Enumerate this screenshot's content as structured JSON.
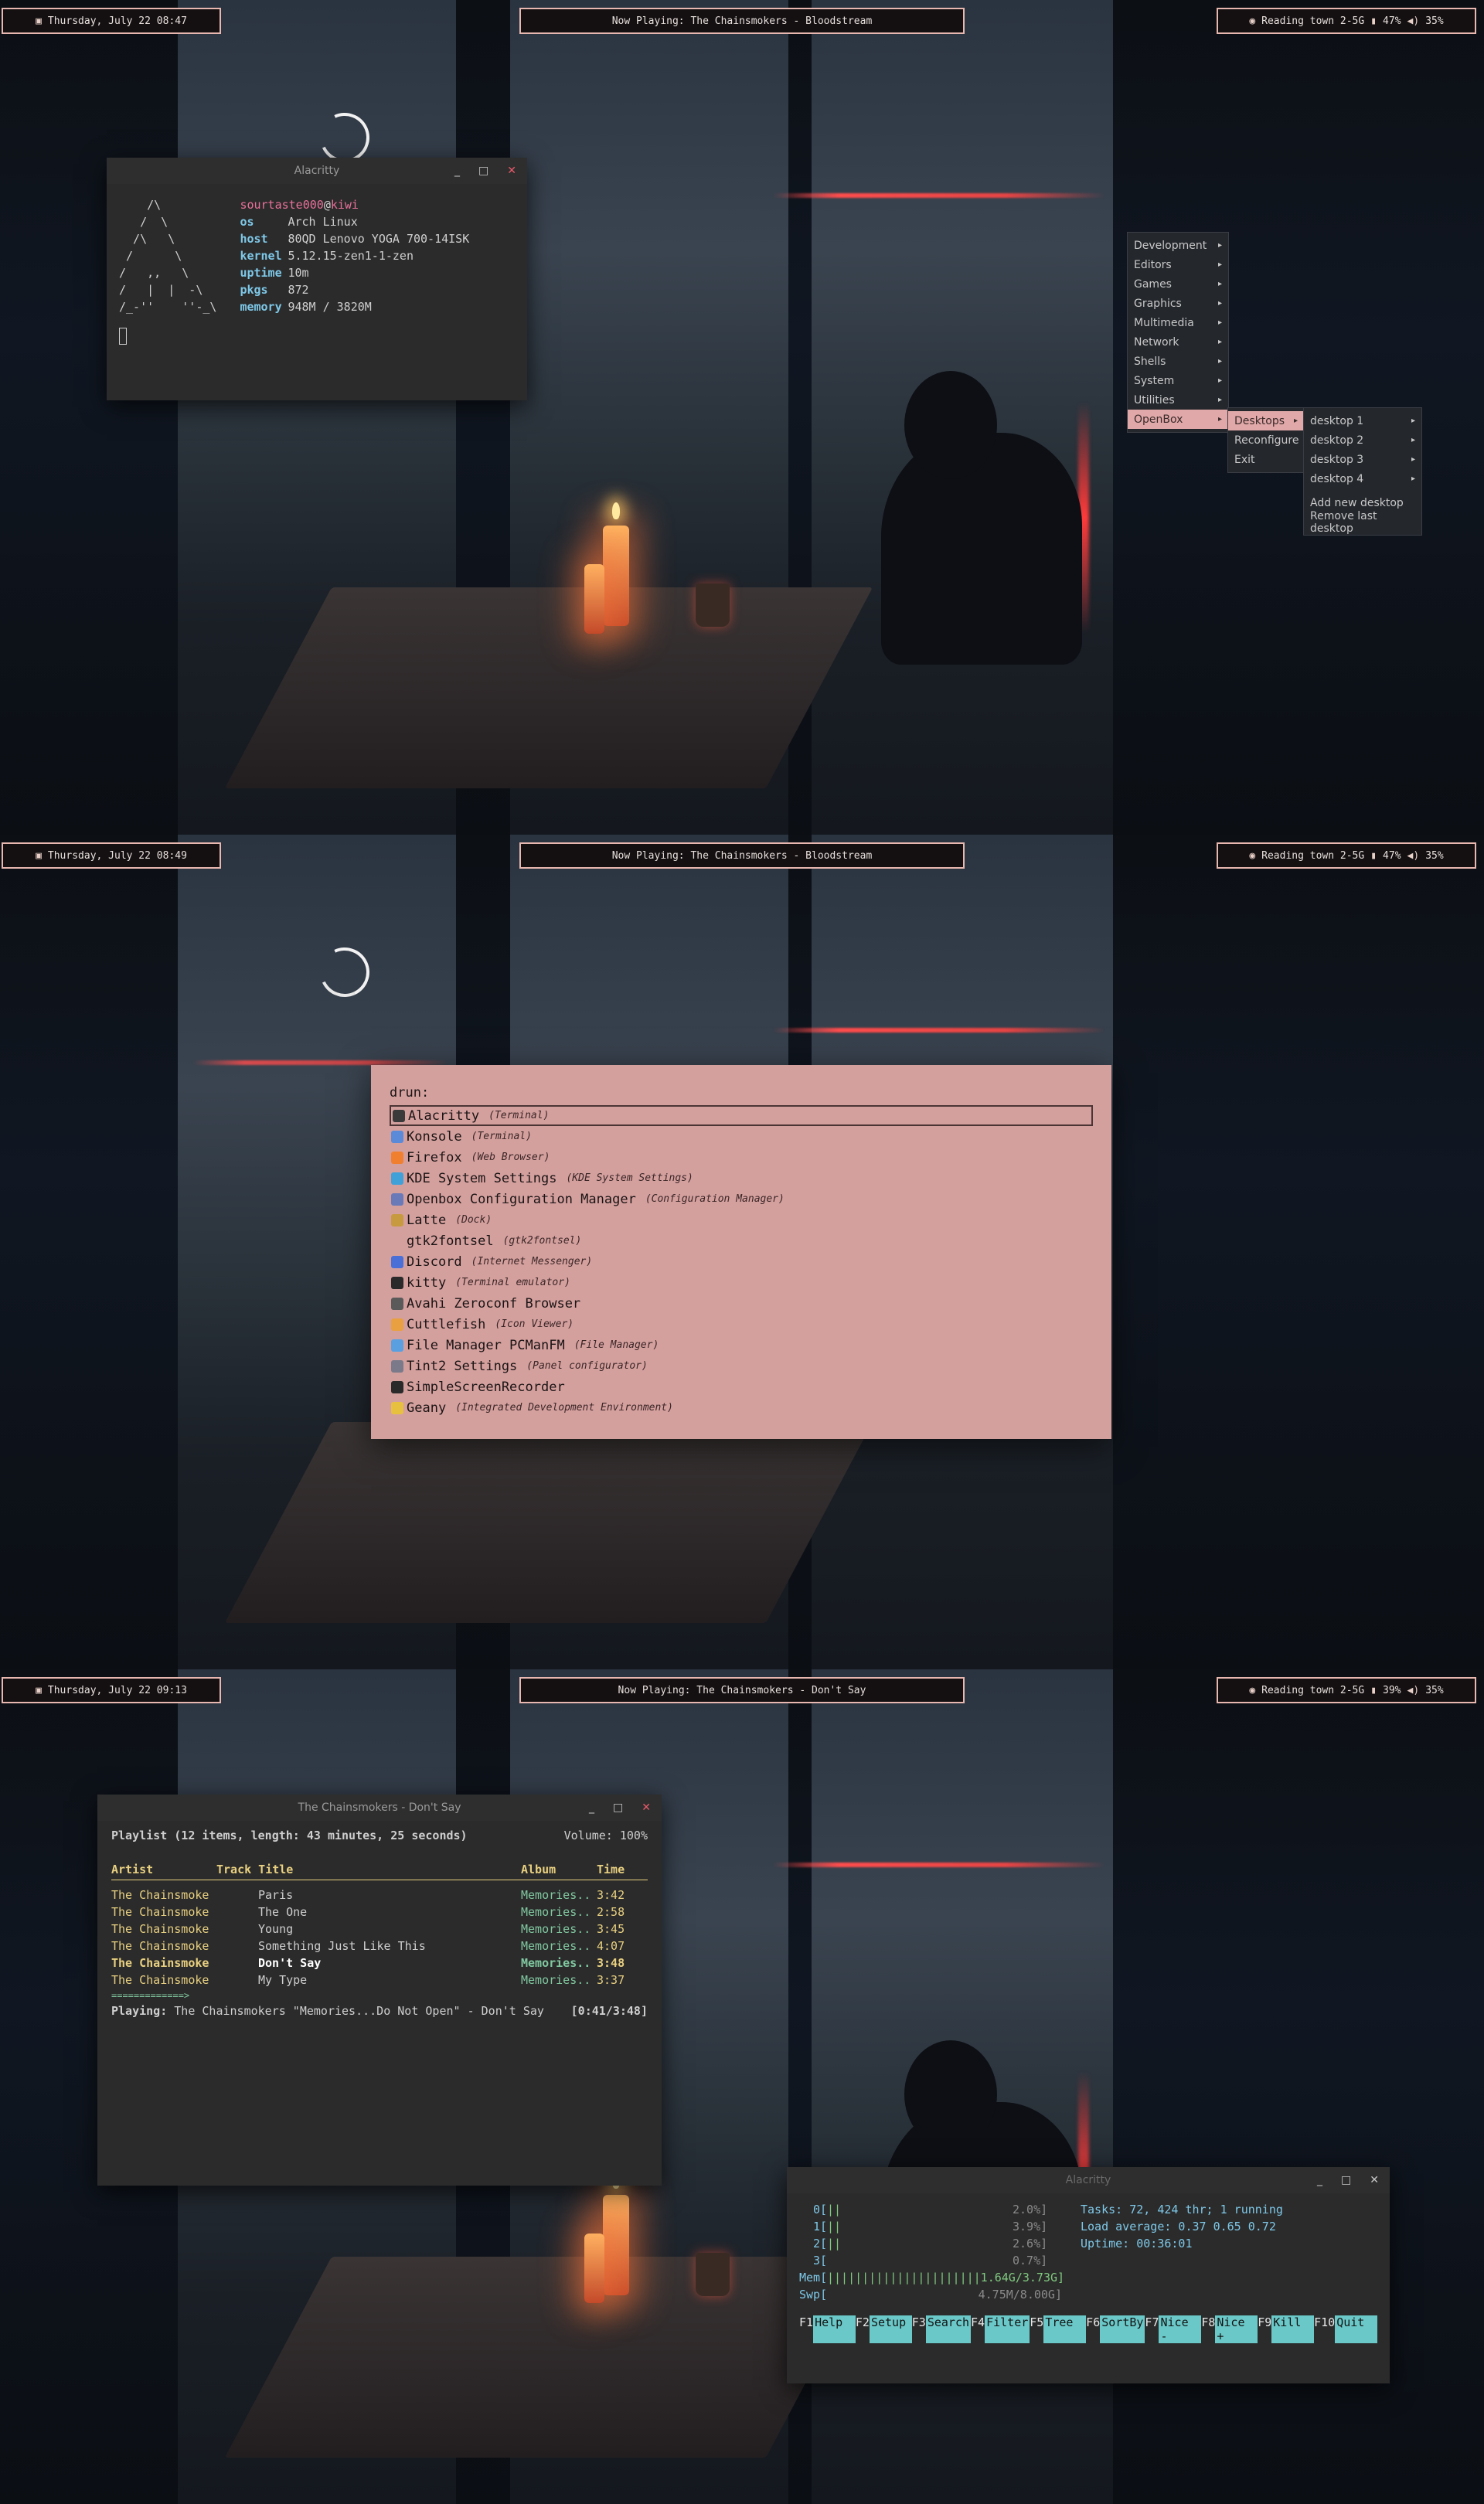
{
  "screens": [
    {
      "bar": {
        "date_icon": "calendar-icon",
        "date": "Thursday, July 22 08:47",
        "now_playing": "Now Playing: The Chainsmokers - Bloodstream",
        "status": "Reading town 2-5G",
        "battery": "47%",
        "volume": "35%"
      },
      "neofetch": {
        "title": "Alacritty",
        "logo": [
          "    /\\",
          "   /  \\",
          "  /\\   \\",
          " /      \\",
          "/   ,,   \\",
          "/   |  |  -\\",
          "/_-''    ''-_\\"
        ],
        "user_host": "sourtaste000@kiwi",
        "user": "sourtaste000",
        "at": "@",
        "host_name": "kiwi",
        "rows": [
          {
            "k": "os",
            "v": "Arch Linux"
          },
          {
            "k": "host",
            "v": "80QD Lenovo YOGA 700-14ISK"
          },
          {
            "k": "kernel",
            "v": "5.12.15-zen1-1-zen"
          },
          {
            "k": "uptime",
            "v": "10m"
          },
          {
            "k": "pkgs",
            "v": "872"
          },
          {
            "k": "memory",
            "v": "948M / 3820M"
          }
        ]
      },
      "menu": {
        "items": [
          "Development",
          "Editors",
          "Games",
          "Graphics",
          "Multimedia",
          "Network",
          "Shells",
          "System",
          "Utilities",
          "OpenBox"
        ],
        "openbox_sub": [
          "Desktops",
          "Reconfigure",
          "Exit"
        ],
        "desktops_sub": [
          "desktop 1",
          "desktop 2",
          "desktop 3",
          "desktop 4",
          "Add new desktop",
          "Remove last desktop"
        ]
      }
    },
    {
      "bar": {
        "date": "Thursday, July 22 08:49",
        "now_playing": "Now Playing: The Chainsmokers - Bloodstream",
        "status": "Reading town 2-5G",
        "battery": "47%",
        "volume": "35%"
      },
      "drun": {
        "prompt": "drun:",
        "items": [
          {
            "name": "Alacritty",
            "sub": "(Terminal)",
            "color": "#3a3a3a"
          },
          {
            "name": "Konsole",
            "sub": "(Terminal)",
            "color": "#5a8ad8"
          },
          {
            "name": "Firefox",
            "sub": "(Web Browser)",
            "color": "#f08030"
          },
          {
            "name": "KDE System Settings",
            "sub": "(KDE System Settings)",
            "color": "#40a0d8"
          },
          {
            "name": "Openbox Configuration Manager",
            "sub": "(Configuration Manager)",
            "color": "#6a7ab8"
          },
          {
            "name": "Latte",
            "sub": "(Dock)",
            "color": "#c89a40"
          },
          {
            "name": "gtk2fontsel",
            "sub": "(gtk2fontsel)",
            "color": "transparent"
          },
          {
            "name": "Discord",
            "sub": "(Internet Messenger)",
            "color": "#4a70d8"
          },
          {
            "name": "kitty",
            "sub": "(Terminal emulator)",
            "color": "#2a2a2a"
          },
          {
            "name": "Avahi Zeroconf Browser",
            "sub": "",
            "color": "#5a5a5a"
          },
          {
            "name": "Cuttlefish",
            "sub": "(Icon Viewer)",
            "color": "#e8a040"
          },
          {
            "name": "File Manager PCManFM",
            "sub": "(File Manager)",
            "color": "#5aa0e0"
          },
          {
            "name": "Tint2 Settings",
            "sub": "(Panel configurator)",
            "color": "#7a7a8a"
          },
          {
            "name": "SimpleScreenRecorder",
            "sub": "",
            "color": "#2a2a2a"
          },
          {
            "name": "Geany",
            "sub": "(Integrated Development Environment)",
            "color": "#e8c040"
          }
        ]
      }
    },
    {
      "bar": {
        "date": "Thursday, July 22 09:13",
        "now_playing": "Now Playing: The Chainsmokers - Don't Say",
        "status": "Reading town 2-5G",
        "battery": "39%",
        "volume": "35%"
      },
      "mpc": {
        "title": "The Chainsmokers - Don't Say",
        "playlist_header": "Playlist (12 items, length: 43 minutes, 25 seconds)",
        "volume": "Volume: 100%",
        "cols": [
          "Artist",
          "Track Title",
          "Album",
          "Time"
        ],
        "rows": [
          {
            "artist": "The Chainsmoke",
            "title": "Paris",
            "album": "Memories..",
            "time": "3:42"
          },
          {
            "artist": "The Chainsmoke",
            "title": "The One",
            "album": "Memories..",
            "time": "2:58"
          },
          {
            "artist": "The Chainsmoke",
            "title": "Young",
            "album": "Memories..",
            "time": "3:45"
          },
          {
            "artist": "The Chainsmoke",
            "title": "Something Just Like This",
            "album": "Memories..",
            "time": "4:07"
          },
          {
            "artist": "The Chainsmoke",
            "title": "Don't Say",
            "album": "Memories..",
            "time": "3:48"
          },
          {
            "artist": "The Chainsmoke",
            "title": "My Type",
            "album": "Memories..",
            "time": "3:37"
          }
        ],
        "progress": "=============>",
        "playing_label": "Playing:",
        "playing_text": "The Chainsmokers \"Memories...Do Not Open\" - Don't Say",
        "playing_time": "[0:41/3:48]"
      },
      "htop": {
        "title": "Alacritty",
        "cpus": [
          {
            "label": "0[",
            "bar": "||",
            "pct": "2.0%]"
          },
          {
            "label": "1[",
            "bar": "||",
            "pct": "3.9%]"
          },
          {
            "label": "2[",
            "bar": "||",
            "pct": "2.6%]"
          },
          {
            "label": "3[",
            "bar": "",
            "pct": "0.7%]"
          }
        ],
        "mem": {
          "label": "Mem[",
          "bar": "||||||||||||||||||||||1.64G/3.73G]"
        },
        "swp": {
          "label": "Swp[",
          "bar": "4.75M/8.00G]"
        },
        "tasks": "Tasks: 72, 424 thr; 1 running",
        "load": "Load average: 0.37 0.65 0.72",
        "uptime": "Uptime: 00:36:01",
        "fkeys": [
          {
            "n": "F1",
            "l": "Help"
          },
          {
            "n": "F2",
            "l": "Setup"
          },
          {
            "n": "F3",
            "l": "Search"
          },
          {
            "n": "F4",
            "l": "Filter"
          },
          {
            "n": "F5",
            "l": "Tree"
          },
          {
            "n": "F6",
            "l": "SortBy"
          },
          {
            "n": "F7",
            "l": "Nice -"
          },
          {
            "n": "F8",
            "l": "Nice +"
          },
          {
            "n": "F9",
            "l": "Kill"
          },
          {
            "n": "F10",
            "l": "Quit"
          }
        ]
      }
    }
  ]
}
